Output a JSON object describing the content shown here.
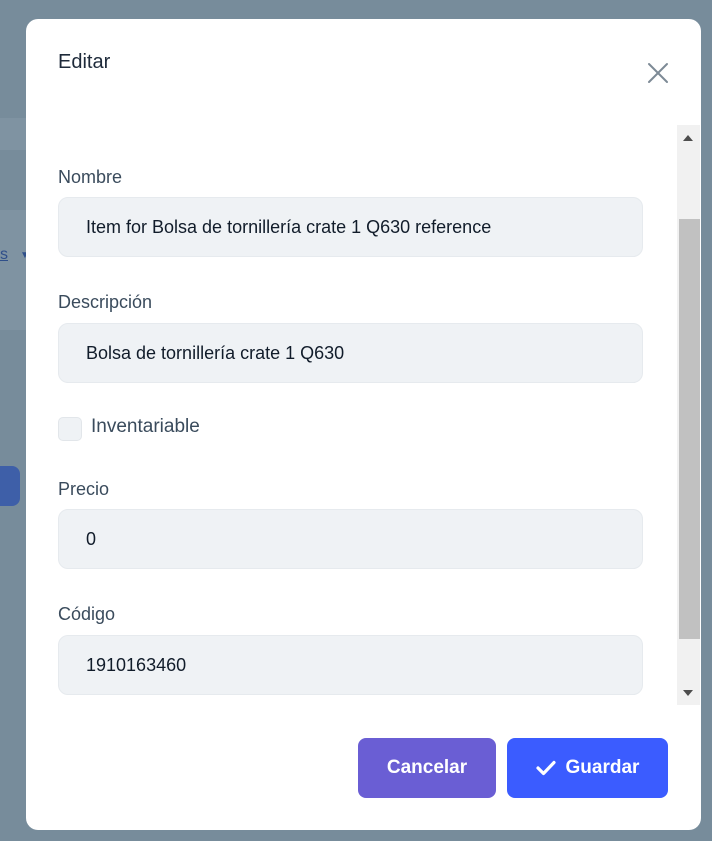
{
  "background": {
    "link_text": "s"
  },
  "dialog": {
    "title": "Editar",
    "close_icon": "close-icon"
  },
  "form": {
    "nombre": {
      "label": "Nombre",
      "value": "Item for Bolsa de tornillería crate 1 Q630 reference"
    },
    "descripcion": {
      "label": "Descripción",
      "value": "Bolsa de tornillería crate 1 Q630"
    },
    "inventariable": {
      "label": "Inventariable",
      "checked": false
    },
    "precio": {
      "label": "Precio",
      "value": "0"
    },
    "codigo": {
      "label": "Código",
      "value": "1910163460"
    }
  },
  "actions": {
    "cancel_label": "Cancelar",
    "save_label": "Guardar",
    "save_icon": "check-icon"
  },
  "colors": {
    "overlay": "#778c9b",
    "cancel_button": "#6a5ed4",
    "save_button": "#3b5cff",
    "input_background": "#eff2f5"
  }
}
